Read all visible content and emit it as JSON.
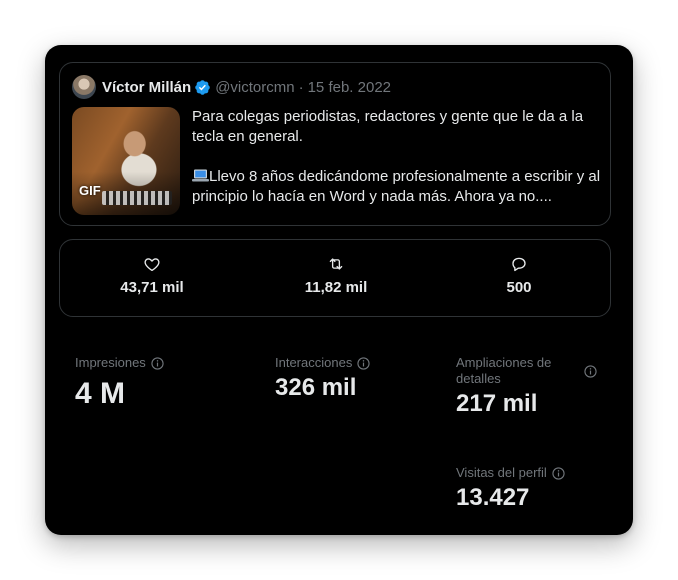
{
  "tweet": {
    "author_name": "Víctor Millán",
    "handle": "@victorcmn",
    "separator": "·",
    "date": "15 feb. 2022",
    "media_badge": "GIF",
    "text_line1": "Para colegas periodistas, redactores y gente que le da a la tecla en general.",
    "text_line2": "Llevo 8 años dedicándome profesionalmente a escribir y al principio lo hacía en Word y nada más. Ahora ya no....",
    "text_line2_emoji": "laptop-icon",
    "verified_color": "#1d9bf0"
  },
  "engagement": {
    "likes": "43,71 mil",
    "likes_icon": "heart-icon",
    "retweets": "11,82 mil",
    "retweets_icon": "retweet-icon",
    "replies": "500",
    "replies_icon": "reply-icon"
  },
  "metrics": {
    "impressions_label": "Impresiones",
    "impressions_value": "4 M",
    "interactions_label": "Interacciones",
    "interactions_value": "326 mil",
    "detail_expansions_label": "Ampliaciones de detalles",
    "detail_expansions_value": "217 mil",
    "profile_visits_label": "Visitas del perfil",
    "profile_visits_value": "13.427"
  },
  "colors": {
    "background": "#000000",
    "text_primary": "#e7e9ea",
    "text_secondary": "#71767b",
    "border": "#2f3336",
    "accent": "#1d9bf0"
  }
}
